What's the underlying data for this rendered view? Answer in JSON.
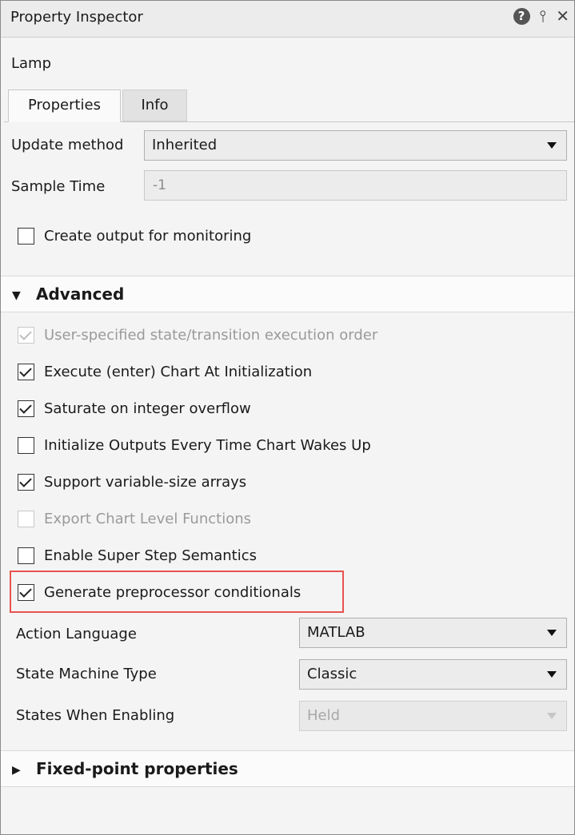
{
  "window": {
    "title": "Property Inspector",
    "icons": [
      "help-icon",
      "pin-icon",
      "close-icon"
    ]
  },
  "block_name": "Lamp",
  "tabs": [
    {
      "label": "Properties",
      "active": true
    },
    {
      "label": "Info",
      "active": false
    }
  ],
  "update_method": {
    "label": "Update method",
    "value": "Inherited"
  },
  "sample_time": {
    "label": "Sample Time",
    "value": "-1"
  },
  "create_output": {
    "label": "Create output for monitoring",
    "checked": false
  },
  "advanced": {
    "title": "Advanced",
    "options": [
      {
        "label": "User-specified state/transition execution order",
        "checked": true,
        "enabled": false
      },
      {
        "label": "Execute (enter) Chart At Initialization",
        "checked": true,
        "enabled": true
      },
      {
        "label": "Saturate on integer overflow",
        "checked": true,
        "enabled": true
      },
      {
        "label": "Initialize Outputs Every Time Chart Wakes Up",
        "checked": false,
        "enabled": true
      },
      {
        "label": "Support variable-size arrays",
        "checked": true,
        "enabled": true
      },
      {
        "label": "Export Chart Level Functions",
        "checked": false,
        "enabled": false
      },
      {
        "label": "Enable Super Step Semantics",
        "checked": false,
        "enabled": true
      },
      {
        "label": "Generate preprocessor conditionals",
        "checked": true,
        "enabled": true,
        "highlighted": true
      }
    ],
    "action_language": {
      "label": "Action Language",
      "value": "MATLAB"
    },
    "state_machine_type": {
      "label": "State Machine Type",
      "value": "Classic"
    },
    "states_when_enabling": {
      "label": "States When Enabling",
      "value": "Held",
      "enabled": false
    }
  },
  "fixed_point": {
    "title": "Fixed-point properties",
    "expanded": false
  },
  "colors": {
    "highlight": "#e8534f",
    "panel": "#f4f4f4"
  }
}
